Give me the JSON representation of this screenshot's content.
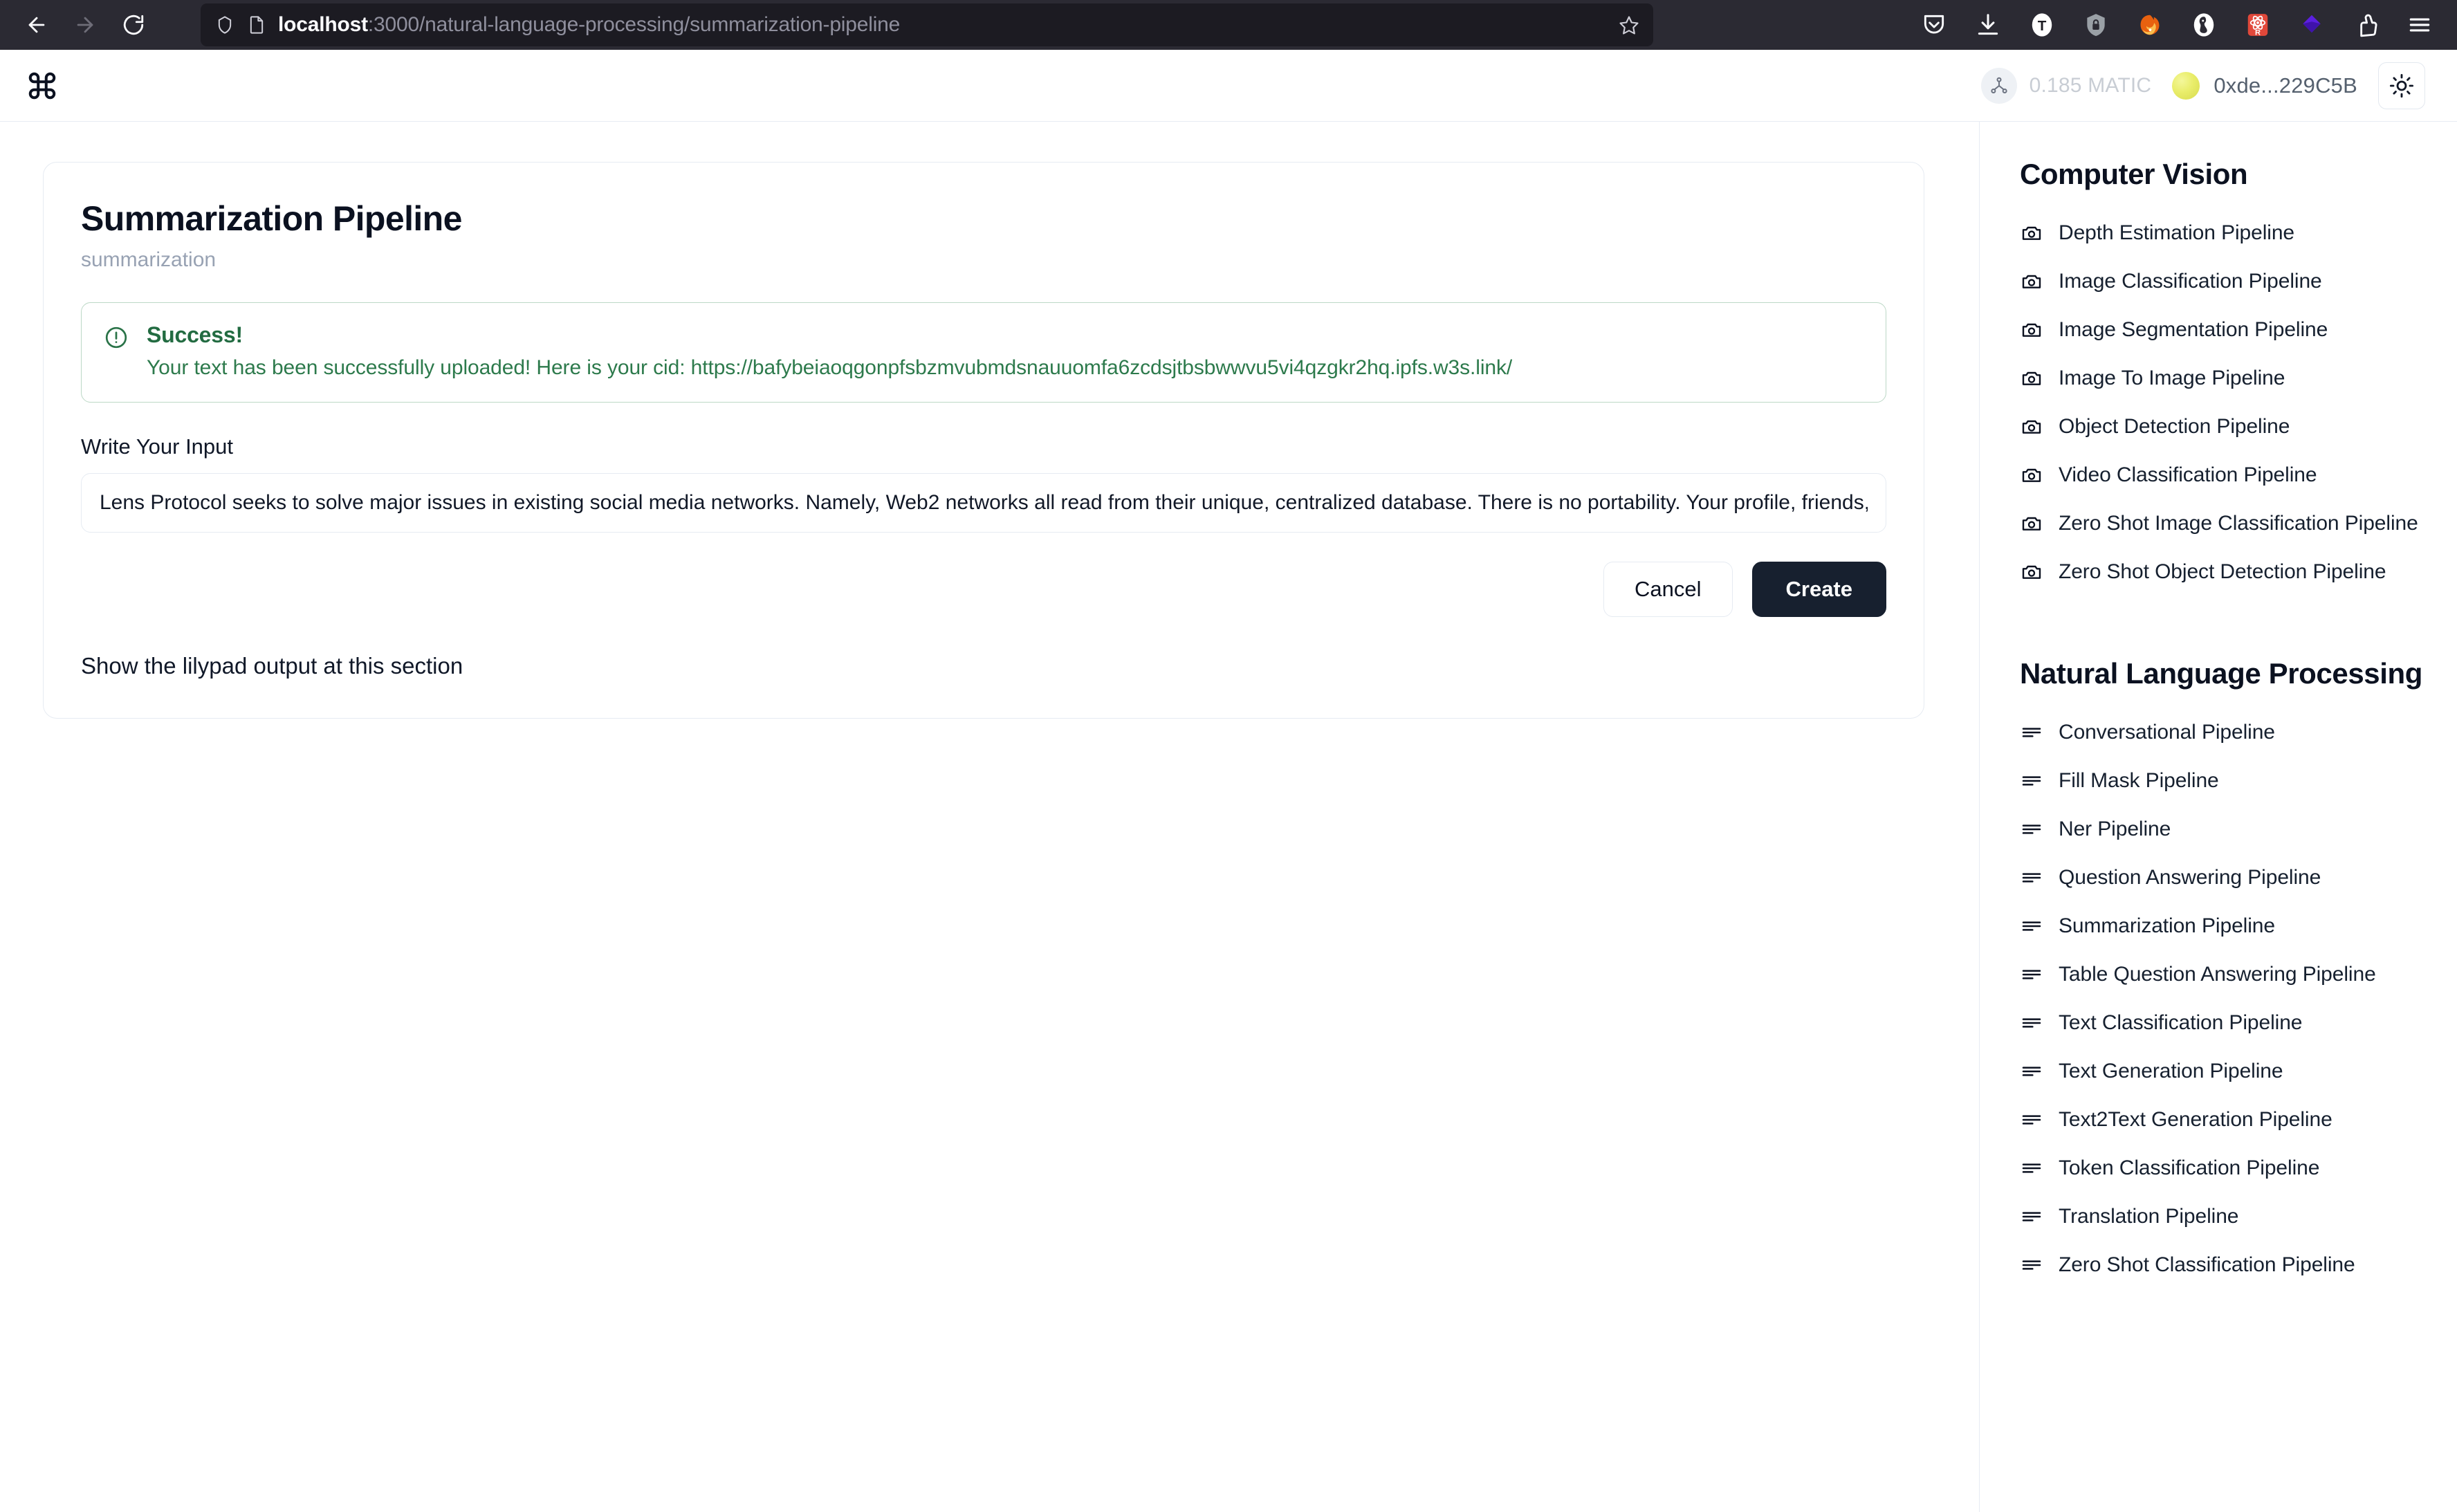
{
  "browser": {
    "back_label": "Back",
    "forward_label": "Forward",
    "reload_label": "Reload",
    "url_host": "localhost",
    "url_path": ":3000/natural-language-processing/summarization-pipeline",
    "bookmark_label": "Bookmark this page",
    "extensions": [
      "pocket-icon",
      "download-icon",
      "tabsync-icon",
      "password-manager-icon",
      "firefox-icon",
      "duckduckgo-icon",
      "react-devtools-icon",
      "wallet-diamond-icon",
      "ublock-icon",
      "app-menu-icon"
    ]
  },
  "header": {
    "logo": "command-logo-icon",
    "balance": "0.185 MATIC",
    "wallet_address": "0xde...229C5B",
    "theme_toggle_label": "Toggle theme"
  },
  "card": {
    "title": "Summarization Pipeline",
    "subtitle": "summarization",
    "alert": {
      "icon": "alert-circle-icon",
      "title": "Success!",
      "message": "Your text has been successfully uploaded! Here is your cid: https://bafybeiaoqgonpfsbzmvubmdsnauuomfa6zcdsjtbsbwwvu5vi4qzgkr2hq.ipfs.w3s.link/"
    },
    "input_label": "Write Your Input",
    "input_value": "Lens Protocol seeks to solve major issues in existing social media networks. Namely, Web2 networks all read from their unique, centralized database. There is no portability. Your profile, friends, and content are locked into one platform.",
    "input_placeholder": "Write Your Input",
    "cancel_label": "Cancel",
    "create_label": "Create",
    "footer_note": "Show the lilypad output at this section"
  },
  "sidebar": {
    "sections": [
      {
        "heading": "Computer Vision",
        "icon": "camera-icon",
        "items": [
          "Depth Estimation Pipeline",
          "Image Classification Pipeline",
          "Image Segmentation Pipeline",
          "Image To Image Pipeline",
          "Object Detection Pipeline",
          "Video Classification Pipeline",
          "Zero Shot Image Classification Pipeline",
          "Zero Shot Object Detection Pipeline"
        ]
      },
      {
        "heading": "Natural Language Processing",
        "icon": "text-lines-icon",
        "items": [
          "Conversational Pipeline",
          "Fill Mask Pipeline",
          "Ner Pipeline",
          "Question Answering Pipeline",
          "Summarization Pipeline",
          "Table Question Answering Pipeline",
          "Text Classification Pipeline",
          "Text Generation Pipeline",
          "Text2Text Generation Pipeline",
          "Token Classification Pipeline",
          "Translation Pipeline",
          "Zero Shot Classification Pipeline"
        ]
      }
    ]
  },
  "colors": {
    "chrome_bg": "#2b2a33",
    "urlbar_bg": "#1c1b22",
    "accent_dark": "#17202f",
    "success": "#226b41",
    "border": "#e6ebf2"
  }
}
